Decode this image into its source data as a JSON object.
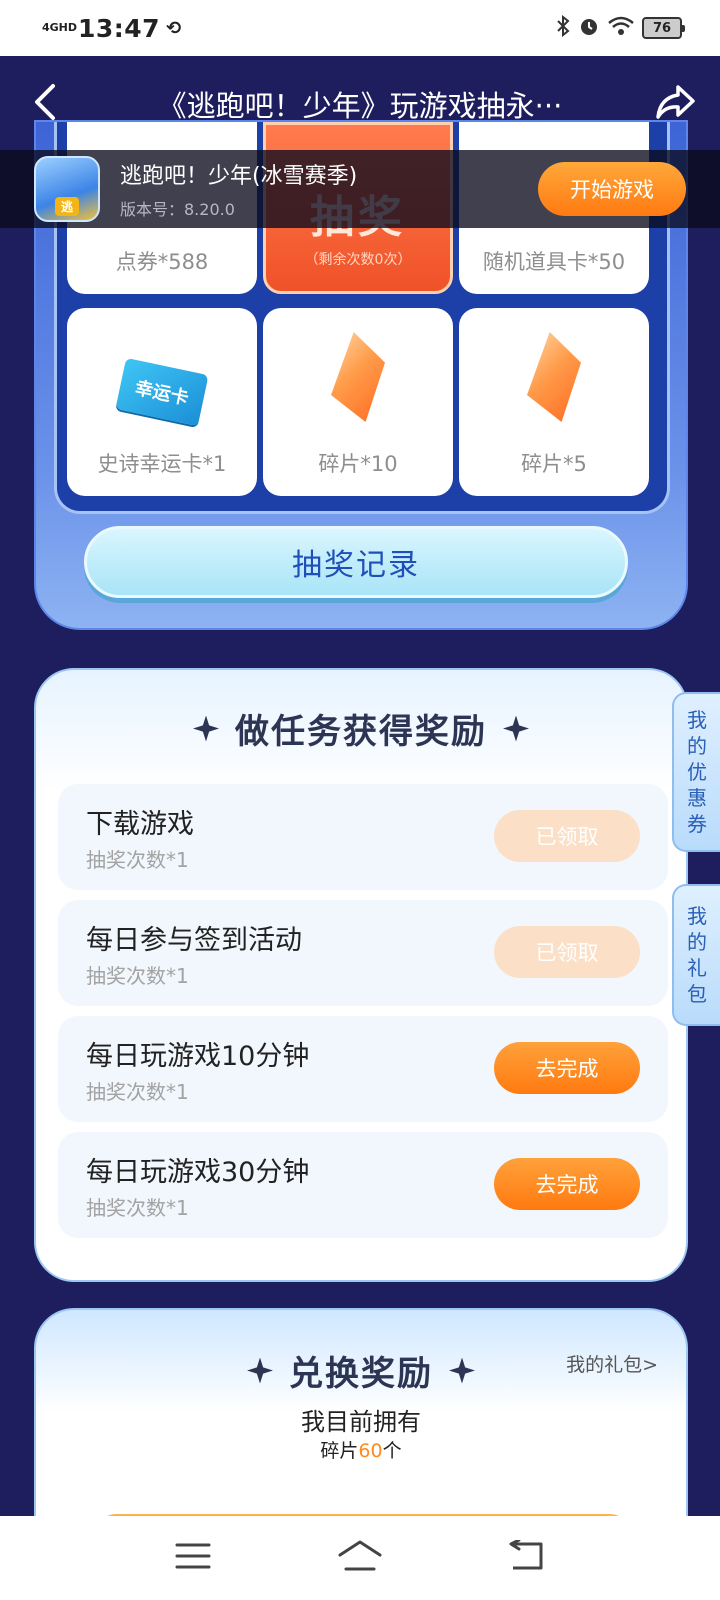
{
  "status_bar": {
    "network": "4GHD",
    "time": "13:47",
    "extra_icon": "sync-icon",
    "battery": "76",
    "icons": [
      "bluetooth-icon",
      "alarm-icon",
      "wifi-icon",
      "battery-icon"
    ]
  },
  "header": {
    "title": "《逃跑吧！少年》玩游戏抽永···",
    "back_icon": "chevron-left-icon",
    "share_icon": "share-icon"
  },
  "game_banner": {
    "name": "逃跑吧！少年(冰雪赛季)",
    "version": "版本号：8.20.0",
    "icon_tag": "逃",
    "start_label": "开始游戏"
  },
  "lottery": {
    "prizes_top": [
      {
        "label": "点券*588"
      },
      {
        "label": "随机道具卡*50"
      }
    ],
    "draw_button": {
      "main": "抽奖",
      "sub": "（剩余次数0次）"
    },
    "prizes_bottom": [
      {
        "label": "史诗幸运卡*1",
        "image_text": "幸运卡"
      },
      {
        "label": "碎片*10"
      },
      {
        "label": "碎片*5"
      }
    ],
    "record_label": "抽奖记录"
  },
  "tasks": {
    "title": "做任务获得奖励",
    "items": [
      {
        "name": "下载游戏",
        "reward": "抽奖次数*1",
        "button": "已领取",
        "state": "claimed"
      },
      {
        "name": "每日参与签到活动",
        "reward": "抽奖次数*1",
        "button": "已领取",
        "state": "claimed"
      },
      {
        "name": "每日玩游戏10分钟",
        "reward": "抽奖次数*1",
        "button": "去完成",
        "state": "todo"
      },
      {
        "name": "每日玩游戏30分钟",
        "reward": "抽奖次数*1",
        "button": "去完成",
        "state": "todo"
      }
    ]
  },
  "side_tabs": {
    "coupons": [
      "我",
      "的",
      "优",
      "惠",
      "券"
    ],
    "gifts": [
      "我",
      "的",
      "礼",
      "包"
    ]
  },
  "exchange": {
    "title": "兑换奖励",
    "my_gifts_link": "我的礼包>",
    "own_title": "我目前拥有",
    "own_prefix": "碎片",
    "own_value": "60",
    "own_suffix": "个"
  },
  "nav": {
    "items": [
      "menu-icon",
      "home-icon",
      "back-icon"
    ]
  },
  "colors": {
    "header_bg": "#1e1d5e",
    "accent_orange": "#ff7a12",
    "claimed_bg": "#fbe0c7",
    "lottery_blue": "#3d64d6"
  }
}
